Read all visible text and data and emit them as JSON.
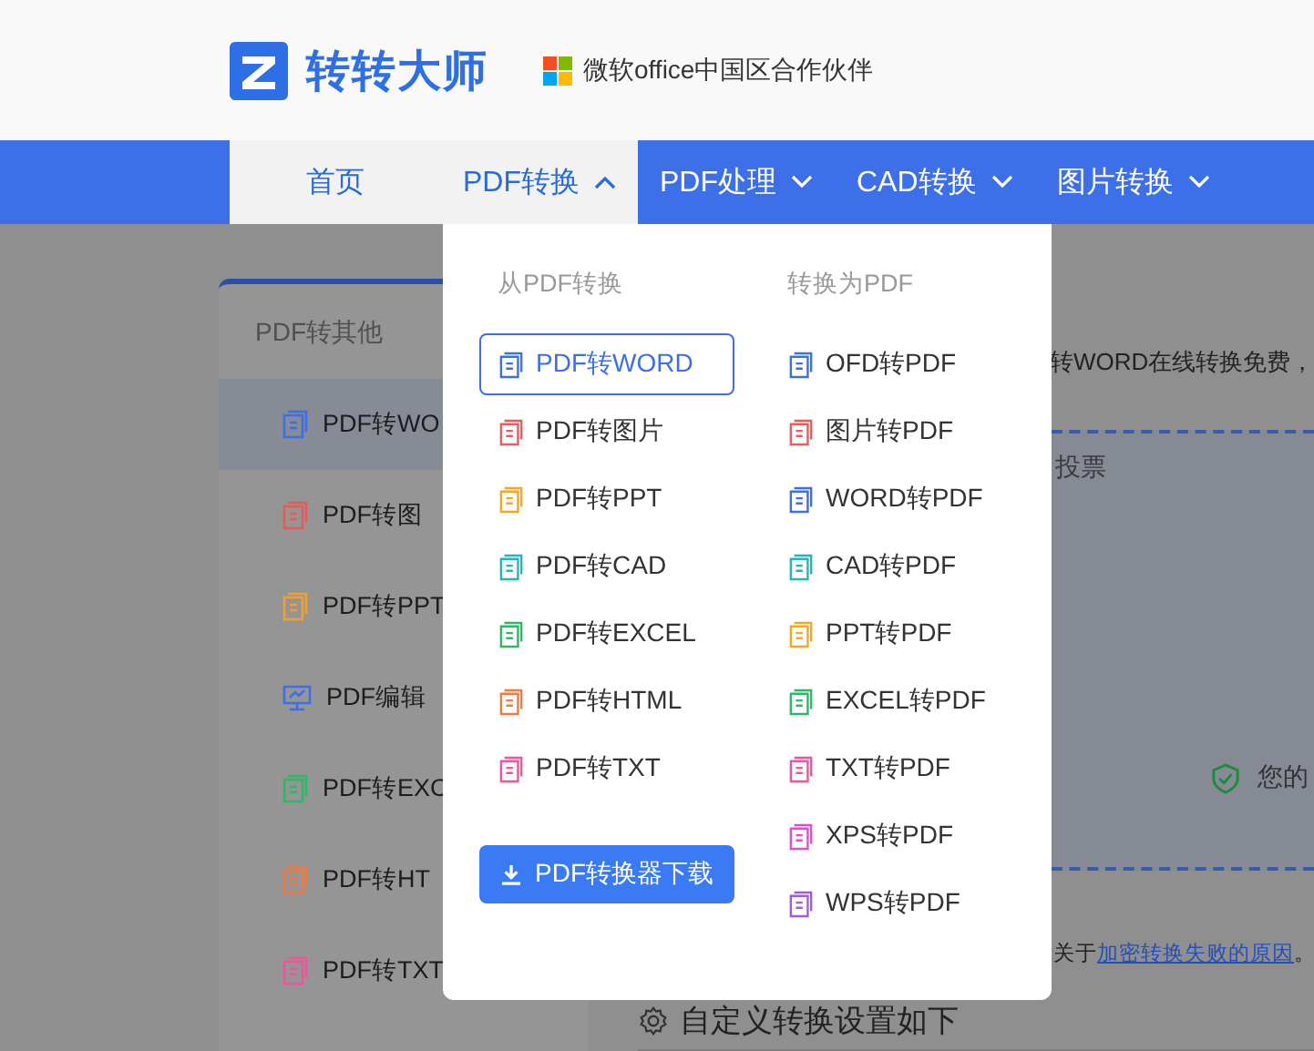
{
  "header": {
    "brand": "转转大师",
    "partner": "微软office中国区合作伙伴"
  },
  "nav": [
    {
      "label": "首页",
      "selected": true
    },
    {
      "label": "PDF转换",
      "selected": true,
      "expanded": true
    },
    {
      "label": "PDF处理",
      "selected": false,
      "expanded": false
    },
    {
      "label": "CAD转换",
      "selected": false,
      "expanded": false
    },
    {
      "label": "图片转换",
      "selected": false,
      "expanded": false
    }
  ],
  "sidebar": {
    "heading": "PDF转其他",
    "items": [
      {
        "label": "PDF转WO",
        "kind": "doc",
        "color": "#3c6fe8",
        "selected": true
      },
      {
        "label": "PDF转图",
        "kind": "doc",
        "color": "#e85a5a",
        "selected": false
      },
      {
        "label": "PDF转PPT",
        "kind": "doc",
        "color": "#f0a030",
        "selected": false
      },
      {
        "label": "PDF编辑",
        "kind": "monitor",
        "color": "#3c6fe8",
        "selected": false
      },
      {
        "label": "PDF转EXC",
        "kind": "doc",
        "color": "#2cb866",
        "selected": false
      },
      {
        "label": "PDF转HT",
        "kind": "doc",
        "color": "#f07b3f",
        "selected": false
      },
      {
        "label": "PDF转TXT",
        "kind": "doc",
        "color": "#f0559b",
        "selected": false
      }
    ]
  },
  "main": {
    "intro": "转WORD在线转换免费，",
    "upload_hint": "投票",
    "security_note": "您的",
    "notice": "关于",
    "notice_link": "加密转换失败的原因",
    "notice_end": "。",
    "settings_heading": "自定义转换设置如下"
  },
  "dropdown": {
    "from_heading": "从PDF转换",
    "to_heading": "转换为PDF",
    "from_items": [
      {
        "label": "PDF转WORD",
        "color": "#3c6fe8",
        "selected": true
      },
      {
        "label": "PDF转图片",
        "color": "#ef5b5b",
        "selected": false
      },
      {
        "label": "PDF转PPT",
        "color": "#f5a623",
        "selected": false
      },
      {
        "label": "PDF转CAD",
        "color": "#25b5b5",
        "selected": false
      },
      {
        "label": "PDF转EXCEL",
        "color": "#2cb866",
        "selected": false
      },
      {
        "label": "PDF转HTML",
        "color": "#f07b3f",
        "selected": false
      },
      {
        "label": "PDF转TXT",
        "color": "#f0559b",
        "selected": false
      }
    ],
    "to_items": [
      {
        "label": "OFD转PDF",
        "color": "#3c6fe8",
        "selected": false
      },
      {
        "label": "图片转PDF",
        "color": "#ef5b5b",
        "selected": false
      },
      {
        "label": "WORD转PDF",
        "color": "#3c6fe8",
        "selected": false
      },
      {
        "label": "CAD转PDF",
        "color": "#25b5b5",
        "selected": false
      },
      {
        "label": "PPT转PDF",
        "color": "#f5a623",
        "selected": false
      },
      {
        "label": "EXCEL转PDF",
        "color": "#2cb866",
        "selected": false
      },
      {
        "label": "TXT转PDF",
        "color": "#f0559b",
        "selected": false
      },
      {
        "label": "XPS转PDF",
        "color": "#e64bd8",
        "selected": false
      },
      {
        "label": "WPS转PDF",
        "color": "#a05be0",
        "selected": false
      }
    ],
    "download_button": "PDF转换器下载"
  }
}
